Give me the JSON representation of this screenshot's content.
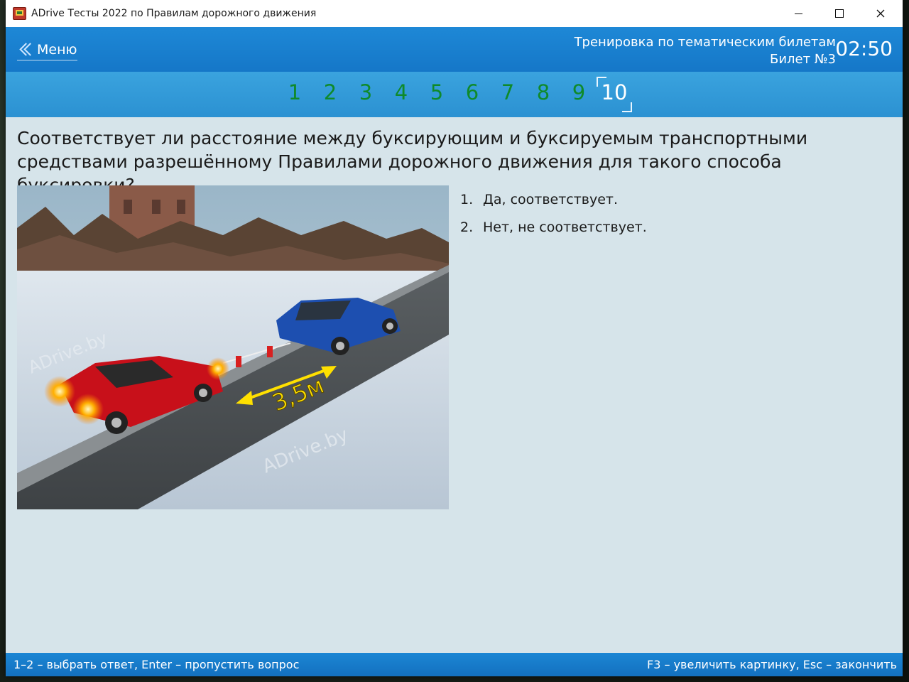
{
  "window": {
    "title": "ADrive Тесты 2022 по Правилам дорожного движения",
    "controls": {
      "minimize": "minimize-icon",
      "maximize": "maximize-icon",
      "close": "close-icon"
    }
  },
  "header": {
    "menu_label": "Меню",
    "mode_title": "Тренировка по тематическим билетам",
    "ticket": "Билет №3",
    "timer": "02:50"
  },
  "question_nav": {
    "items": [
      "1",
      "2",
      "3",
      "4",
      "5",
      "6",
      "7",
      "8",
      "9",
      "10"
    ],
    "current": "10",
    "accent_answered": "#0f8a2a",
    "accent_current": "#ffffff"
  },
  "question": {
    "text": "Соответствует ли расстояние между буксирующим и буксируемым транспортными средствами разрешённому Правилами дорожного движения для такого способа буксировки?"
  },
  "picture": {
    "distance_label": "3,5м",
    "watermark_1": "ADrive.by",
    "watermark_2": "ADrive.by"
  },
  "answers": [
    {
      "num": "1.",
      "text": "Да, соответствует."
    },
    {
      "num": "2.",
      "text": "Нет, не соответствует."
    }
  ],
  "status": {
    "left_hint": "1–2 – выбрать ответ, Enter – пропустить вопрос",
    "right_hint": "F3 – увеличить картинку, Esc – закончить"
  }
}
